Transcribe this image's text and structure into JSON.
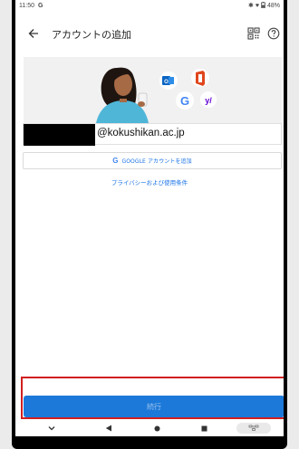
{
  "status": {
    "time": "11:50",
    "app_letter": "G",
    "battery": "48%"
  },
  "appbar": {
    "title": "アカウントの追加"
  },
  "email": {
    "domain": "@kokushikan.ac.jp"
  },
  "google_button": {
    "label": "GOOGLE アカウントを追加"
  },
  "links": {
    "privacy": "プライバシーおよび使用条件"
  },
  "continue_button": {
    "label": "続行"
  },
  "colors": {
    "primary": "#1c79d9",
    "highlight": "#d11f1f",
    "link": "#1a73e8"
  }
}
